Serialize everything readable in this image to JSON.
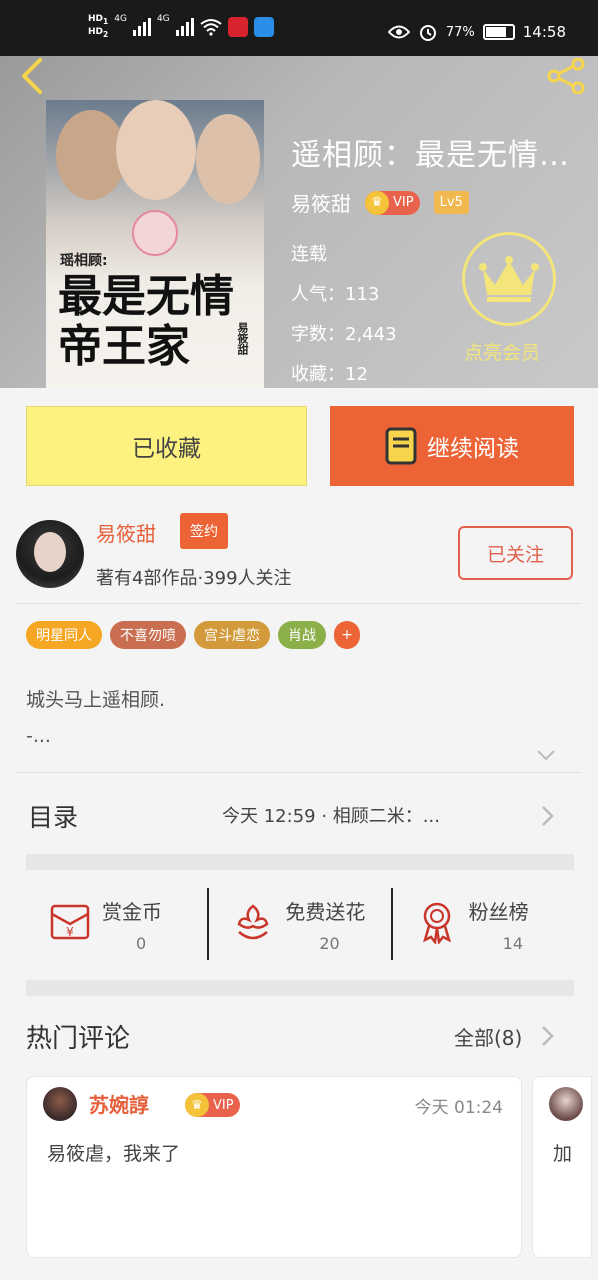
{
  "status_bar": {
    "net1": "HD",
    "net1_sub": "1",
    "net2": "HD",
    "net2_sub": "2",
    "sig1": "4G",
    "sig2": "4G",
    "battery": "77%",
    "battery_level": 0.77,
    "time": "14:58"
  },
  "book": {
    "title": "遥相顾：最是无情帝王家",
    "author": "易筱甜",
    "vip": "VIP",
    "level": "Lv5",
    "status": "连载",
    "popularity": "人气：113",
    "word_count": "字数：2,443",
    "favorites": "收藏：12",
    "member_label": "点亮会员",
    "cover": {
      "small_title": "瑶相顾:",
      "big_title": "最是无情帝王家",
      "author_mark": "易筱甜"
    }
  },
  "actions": {
    "collected_label": "已收藏",
    "continue_label": "继续阅读"
  },
  "author_card": {
    "name": "易筱甜",
    "signed": "签约",
    "stats": "著有4部作品·399人关注",
    "follow_label": "已关注"
  },
  "tags": [
    {
      "label": "明星同人",
      "color": "#f5a623"
    },
    {
      "label": "不喜勿喷",
      "color": "#c96e50"
    },
    {
      "label": "宫斗虐恋",
      "color": "#d29a3a"
    },
    {
      "label": "肖战",
      "color": "#8bb04a"
    }
  ],
  "tag_more": "+",
  "summary": {
    "line1": "城头马上遥相顾.",
    "line2": "-..."
  },
  "toc": {
    "label": "目录",
    "latest": "今天 12:59 · 相顾二米：..."
  },
  "rewards": [
    {
      "label": "赏金币",
      "value": "0"
    },
    {
      "label": "免费送花",
      "value": "20"
    },
    {
      "label": "粉丝榜",
      "value": "14"
    }
  ],
  "comments": {
    "title": "热门评论",
    "all_label": "全部(8)",
    "items": [
      {
        "user": "苏婉諄",
        "vip": "VIP",
        "time": "今天 01:24",
        "text": "易筱虐，我来了"
      },
      {
        "text": "加"
      }
    ]
  },
  "colors": {
    "accent": "#ec6436",
    "yellow_button": "#fdf27f",
    "member_gold": "#f3e57a"
  }
}
